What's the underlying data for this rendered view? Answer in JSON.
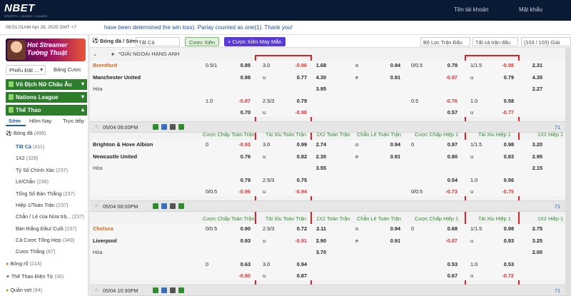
{
  "header": {
    "logo": "NBET",
    "logo_sub": "SPORTS • CASINO • GAMES",
    "username_placeholder": "Tên tài khoản",
    "password_placeholder": "Mật khẩu"
  },
  "ticker": {
    "time": "08:51:01AM Apr 28, 2025 GMT +7",
    "message": "have been determined the win loss). Parlay counted as one(1). Thank you!"
  },
  "banner": {
    "line1": "Hot Streamer",
    "line2": "Tường Thuật"
  },
  "sidebar": {
    "tab_a": "Phiếu Đặt ...",
    "tab_b": "Bảng Cược",
    "groups": [
      "Vô Địch Nữ Châu Âu",
      "Nations League",
      "Thể Thao"
    ],
    "periods": [
      "Sớm",
      "Hôm Nay",
      "Trực tiếp"
    ],
    "sports": [
      {
        "label": "Bóng đá",
        "count": "(498)"
      },
      {
        "label": "Tất Cả",
        "count": "(411)"
      },
      {
        "label": "1X2",
        "count": "(328)"
      },
      {
        "label": "Tỷ Số Chính Xác",
        "count": "(237)"
      },
      {
        "label": "Lẻ/Chẵn",
        "count": "(236)"
      },
      {
        "label": "Tổng Số Bàn Thắng",
        "count": "(237)"
      },
      {
        "label": "Hiệp 1/Toàn Trận",
        "count": "(237)"
      },
      {
        "label": "Chẵn / Lẻ của Nửa trậ...",
        "count": "(237)"
      },
      {
        "label": "Bàn thắng Đầu/ Cuối",
        "count": "(237)"
      },
      {
        "label": "Cá Cược Tổng Hợp",
        "count": "(349)"
      },
      {
        "label": "Cược Thắng",
        "count": "(87)"
      },
      {
        "label": "Bóng rổ",
        "count": "(214)"
      },
      {
        "label": "Thể Thao Điện Tử",
        "count": "(36)"
      },
      {
        "label": "Quần vợt",
        "count": "(94)"
      }
    ]
  },
  "controls": {
    "sport": "Bóng đá / Sớm",
    "filter": "Tất Cả",
    "parlay": "Cược Xiên",
    "lucky_parlay": "Cược Xiên May Mắn",
    "match_filter": "Bộ Lọc Trận Đấu",
    "all_matches": "Tất cả trận đấu",
    "pages": "(103 / 103) Giải"
  },
  "league": "*GIẢI NGOẠI HẠNG ANH",
  "columns": [
    "Cược Chấp Toàn Trận",
    "Tài Xỉu Toàn Trận",
    "1X2 Toàn Trận",
    "Chẵn Lẻ Toàn Trận",
    "Cược Chấp Hiệp 1",
    "Tài Xỉu Hiệp 1",
    "1X2 Hiệp 1"
  ],
  "draw": "Hòa",
  "matches": [
    {
      "home": "Brentford",
      "away": "Manchester United",
      "date": "05/04 08:00PM",
      "more": "71",
      "r1": {
        "h1": "0.5/1",
        "h2": "0.85",
        "t1": "3.0",
        "t2": "-0.96",
        "x": "1.68",
        "e1": "o",
        "e2": "0.94",
        "c1": "0/0.5",
        "c2": "0.78",
        "u1": "1/1.5",
        "u2": "-0.98",
        "y": "2.31"
      },
      "r2": {
        "h2": "0.98",
        "t1": "u",
        "t2": "0.77",
        "x": "4.30",
        "e1": "e",
        "e2": "0.91",
        "c2": "-0.97",
        "u1": "u",
        "u2": "0.79",
        "y": "4.35"
      },
      "r3": {
        "x": "3.95",
        "y": "2.27"
      },
      "r4": {
        "h1": "1.0",
        "h2": "-0.87",
        "t1": "2.5/3",
        "t2": "0.79",
        "c1": "0.5",
        "c2": "-0.76",
        "u1": "1.0",
        "u2": "0.58"
      },
      "r5": {
        "h2": "0.70",
        "t1": "u",
        "t2": "-0.98",
        "c2": "0.57",
        "u1": "u",
        "u2": "-0.77"
      }
    },
    {
      "home": "Brighton & Hove Albion",
      "away": "Newcastle United",
      "date": "05/04 08:00PM",
      "more": "71",
      "r1": {
        "h1": "0",
        "h2": "-0.93",
        "t1": "3.0",
        "t2": "0.99",
        "x": "2.74",
        "e1": "o",
        "e2": "0.94",
        "c1": "0",
        "c2": "0.97",
        "u1": "1/1.5",
        "u2": "0.98",
        "y": "3.20"
      },
      "r2": {
        "h2": "0.76",
        "t1": "u",
        "t2": "0.82",
        "x": "2.30",
        "e1": "e",
        "e2": "0.91",
        "c2": "0.80",
        "u1": "u",
        "u2": "0.83",
        "y": "2.95"
      },
      "r3": {
        "x": "3.55",
        "y": "2.15"
      },
      "r4": {
        "h2": "0.79",
        "t1": "2.5/3",
        "t2": "0.75",
        "c2": "0.54",
        "u1": "1.0",
        "u2": "0.56"
      },
      "r5": {
        "h1": "0/0.5",
        "h2": "-0.96",
        "t1": "u",
        "t2": "-0.94",
        "c1": "0/0.5",
        "c2": "-0.73",
        "u1": "u",
        "u2": "-0.75"
      }
    },
    {
      "home": "Chelsea",
      "away": "Liverpool",
      "date": "05/04 10:30PM",
      "more": "71",
      "r1": {
        "h1": "0/0.5",
        "h2": "0.90",
        "t1": "2.5/3",
        "t2": "0.72",
        "x": "2.11",
        "e1": "o",
        "e2": "0.94",
        "c1": "0",
        "c2": "0.68",
        "u1": "1/1.5",
        "u2": "0.98",
        "y": "2.75"
      },
      "r2": {
        "h2": "0.93",
        "t1": "u",
        "t2": "-0.91",
        "x": "2.90",
        "e1": "e",
        "e2": "0.91",
        "c2": "-0.87",
        "u1": "u",
        "u2": "0.83",
        "y": "3.25"
      },
      "r3": {
        "x": "3.70",
        "y": "2.00"
      },
      "r4": {
        "h1": "0",
        "h2": "0.63",
        "t1": "3.0",
        "t2": "0.94",
        "c2": "0.53",
        "u1": "1.0",
        "u2": "0.53"
      },
      "r5": {
        "h2": "-0.80",
        "t1": "u",
        "t2": "0.87",
        "c2": "0.67",
        "u1": "u",
        "u2": "-0.72"
      }
    }
  ],
  "colors": {
    "header_bg": "#0b1a34",
    "group_green": "#2d7d2d",
    "highlight_red": "#e02020",
    "negative_odds": "#dd3333",
    "column_header": "#2e8b2e"
  }
}
